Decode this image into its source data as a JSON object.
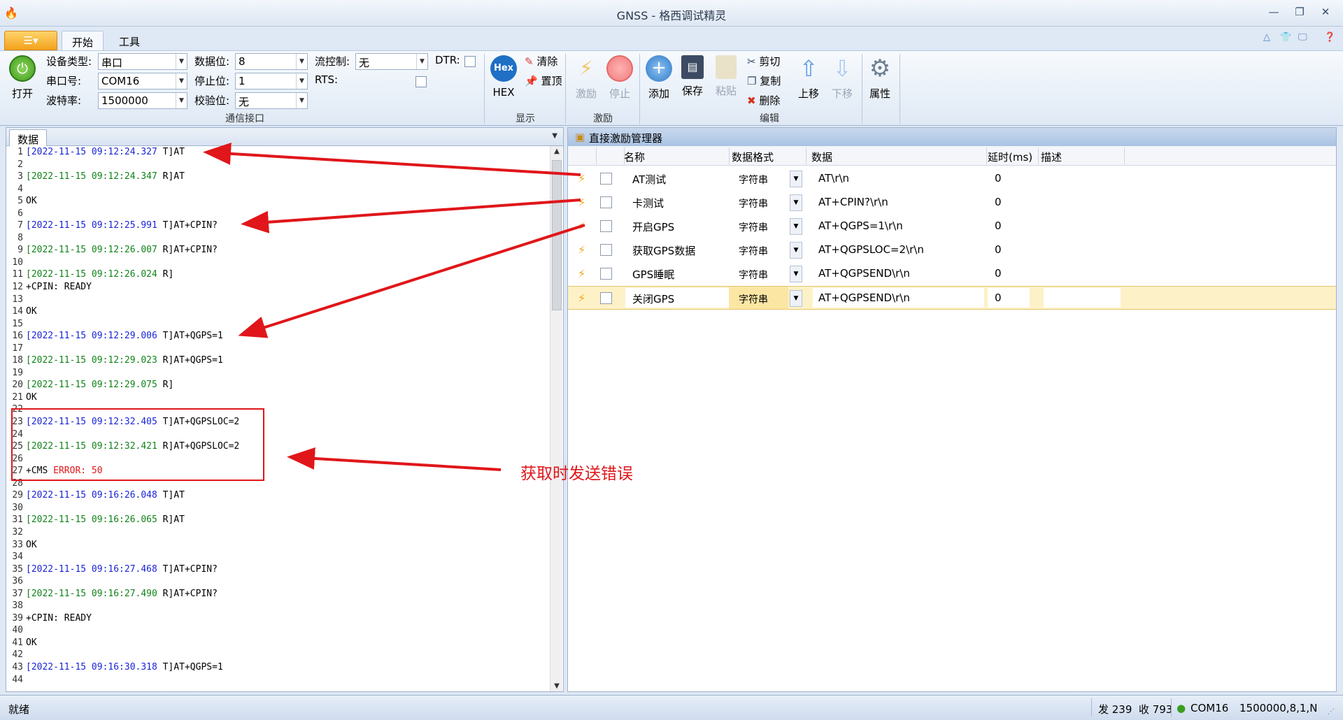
{
  "window": {
    "title": "GNSS - 格西调试精灵",
    "controls": [
      "minimize-icon",
      "restore-icon",
      "close-icon"
    ]
  },
  "tabs": [
    {
      "label": "开始",
      "active": true
    },
    {
      "label": "工具",
      "active": false
    }
  ],
  "ribbon": {
    "comm": {
      "group_title": "通信接口",
      "open_label": "打开",
      "device_type_label": "设备类型:",
      "device_type_value": "串口",
      "port_label": "串口号:",
      "port_value": "COM16",
      "baud_label": "波特率:",
      "baud_value": "1500000",
      "databits_label": "数据位:",
      "databits_value": "8",
      "stopbits_label": "停止位:",
      "stopbits_value": "1",
      "parity_label": "校验位:",
      "parity_value": "无",
      "flow_label": "流控制:",
      "flow_value": "无",
      "dtr_label": "DTR:",
      "rts_label": "RTS:"
    },
    "display": {
      "group_title": "显示",
      "hex_label": "HEX",
      "hex_icon_text": "Hex",
      "clear_label": "清除",
      "top_label": "置顶"
    },
    "stim": {
      "group_title": "激励",
      "stim_label": "激励",
      "stop_label": "停止"
    },
    "edit": {
      "group_title": "编辑",
      "add_label": "添加",
      "save_label": "保存",
      "paste_label": "粘贴",
      "cut_label": "剪切",
      "copy_label": "复制",
      "delete_label": "删除",
      "up_label": "上移",
      "down_label": "下移",
      "props_label": "属性"
    }
  },
  "left_panel": {
    "tab_label": "数据",
    "lines": [
      {
        "n": "1",
        "ts": "[2022-11-15 09:12:24.327 ",
        "dir": "T",
        "rest": "]AT"
      },
      {
        "n": "2",
        "text": ""
      },
      {
        "n": "3",
        "ts": "[2022-11-15 09:12:24.347 ",
        "dir": "R",
        "rest": "]AT"
      },
      {
        "n": "4",
        "text": ""
      },
      {
        "n": "5",
        "text": "OK"
      },
      {
        "n": "6",
        "text": ""
      },
      {
        "n": "7",
        "ts": "[2022-11-15 09:12:25.991 ",
        "dir": "T",
        "rest": "]AT+CPIN?"
      },
      {
        "n": "8",
        "text": ""
      },
      {
        "n": "9",
        "ts": "[2022-11-15 09:12:26.007 ",
        "dir": "R",
        "rest": "]AT+CPIN?"
      },
      {
        "n": "10",
        "text": ""
      },
      {
        "n": "11",
        "ts": "[2022-11-15 09:12:26.024 ",
        "dir": "R",
        "rest": "]"
      },
      {
        "n": "12",
        "text": "+CPIN: READY"
      },
      {
        "n": "13",
        "text": ""
      },
      {
        "n": "14",
        "text": "OK"
      },
      {
        "n": "15",
        "text": ""
      },
      {
        "n": "16",
        "ts": "[2022-11-15 09:12:29.006 ",
        "dir": "T",
        "rest": "]AT+QGPS=1"
      },
      {
        "n": "17",
        "text": ""
      },
      {
        "n": "18",
        "ts": "[2022-11-15 09:12:29.023 ",
        "dir": "R",
        "rest": "]AT+QGPS=1"
      },
      {
        "n": "19",
        "text": ""
      },
      {
        "n": "20",
        "ts": "[2022-11-15 09:12:29.075 ",
        "dir": "R",
        "rest": "]"
      },
      {
        "n": "21",
        "text": "OK"
      },
      {
        "n": "22",
        "text": ""
      },
      {
        "n": "23",
        "ts": "[2022-11-15 09:12:32.405 ",
        "dir": "T",
        "rest": "]AT+QGPSLOC=2"
      },
      {
        "n": "24",
        "text": ""
      },
      {
        "n": "25",
        "ts": "[2022-11-15 09:12:32.421 ",
        "dir": "R",
        "rest": "]AT+QGPSLOC=2"
      },
      {
        "n": "26",
        "text": ""
      },
      {
        "n": "27",
        "text": "+CMS ",
        "err": "ERROR: 50"
      },
      {
        "n": "28",
        "text": ""
      },
      {
        "n": "29",
        "ts": "[2022-11-15 09:16:26.048 ",
        "dir": "T",
        "rest": "]AT"
      },
      {
        "n": "30",
        "text": ""
      },
      {
        "n": "31",
        "ts": "[2022-11-15 09:16:26.065 ",
        "dir": "R",
        "rest": "]AT"
      },
      {
        "n": "32",
        "text": ""
      },
      {
        "n": "33",
        "text": "OK"
      },
      {
        "n": "34",
        "text": ""
      },
      {
        "n": "35",
        "ts": "[2022-11-15 09:16:27.468 ",
        "dir": "T",
        "rest": "]AT+CPIN?"
      },
      {
        "n": "36",
        "text": ""
      },
      {
        "n": "37",
        "ts": "[2022-11-15 09:16:27.490 ",
        "dir": "R",
        "rest": "]AT+CPIN?"
      },
      {
        "n": "38",
        "text": ""
      },
      {
        "n": "39",
        "text": "+CPIN: READY"
      },
      {
        "n": "40",
        "text": ""
      },
      {
        "n": "41",
        "text": "OK"
      },
      {
        "n": "42",
        "text": ""
      },
      {
        "n": "43",
        "ts": "[2022-11-15 09:16:30.318 ",
        "dir": "T",
        "rest": "]AT+QGPS=1"
      },
      {
        "n": "44",
        "text": ""
      }
    ]
  },
  "right_panel": {
    "title": "直接激励管理器",
    "columns": {
      "name": "名称",
      "format": "数据格式",
      "data": "数据",
      "delay": "延时(ms)",
      "desc": "描述"
    },
    "rows": [
      {
        "name": "AT测试",
        "format": "字符串",
        "data": "AT\\r\\n",
        "delay": "0"
      },
      {
        "name": "卡测试",
        "format": "字符串",
        "data": "AT+CPIN?\\r\\n",
        "delay": "0"
      },
      {
        "name": "开启GPS",
        "format": "字符串",
        "data": "AT+QGPS=1\\r\\n",
        "delay": "0"
      },
      {
        "name": "获取GPS数据",
        "format": "字符串",
        "data": "AT+QGPSLOC=2\\r\\n",
        "delay": "0"
      },
      {
        "name": "GPS睡眠",
        "format": "字符串",
        "data": "AT+QGPSEND\\r\\n",
        "delay": "0"
      },
      {
        "name": "关闭GPS",
        "format": "字符串",
        "data": "AT+QGPSEND\\r\\n",
        "delay": "0",
        "selected": true
      }
    ]
  },
  "annotation": {
    "text": "获取时发送错误",
    "color": "#e0161a"
  },
  "status_bar": {
    "status": "就绪",
    "counts": "发 239  收 793",
    "port": "COM16",
    "params": "1500000,8,1,N"
  }
}
